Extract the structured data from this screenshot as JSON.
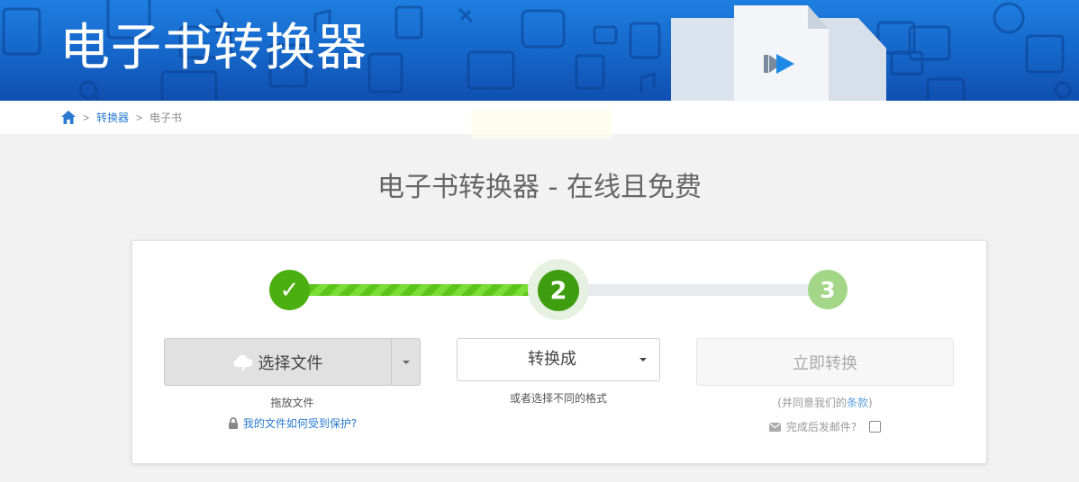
{
  "banner": {
    "title": "电子书转换器"
  },
  "breadcrumb": {
    "separator": ">",
    "converter_link": "转换器",
    "current": "电子书"
  },
  "heading": "电子书转换器 - 在线且免费",
  "steps": {
    "step1_symbol": "✓",
    "step2_number": "2",
    "step3_number": "3",
    "progress_fraction": 0.5
  },
  "upload": {
    "choose_file_label": "选择文件",
    "drop_text": "拖放文件",
    "protection_link": "我的文件如何受到保护?"
  },
  "convert_to": {
    "label": "转换成",
    "hint": "或者选择不同的格式"
  },
  "convert_now": {
    "label": "立即转换",
    "agree_prefix": "(并同意我们的",
    "terms_link": "条款",
    "agree_suffix": ")",
    "email_label": "完成后发邮件?"
  },
  "colors": {
    "banner_blue": "#1565c8",
    "step_green": "#4caf11",
    "link_blue": "#2a7ad2"
  }
}
